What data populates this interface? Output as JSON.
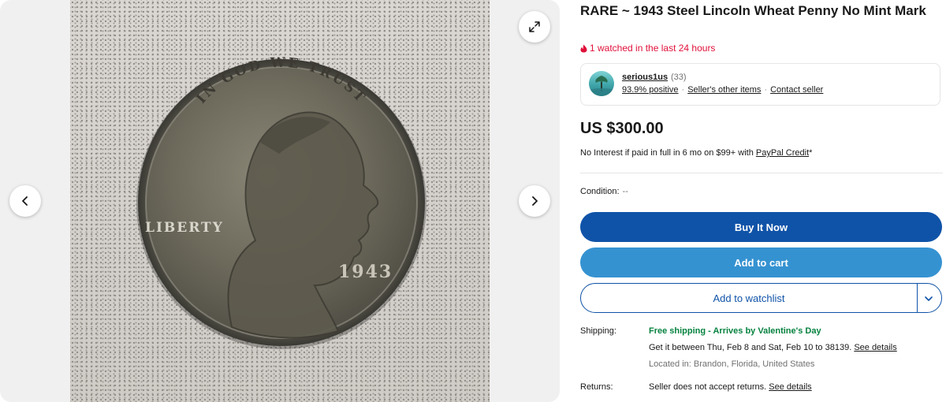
{
  "gallery": {
    "prev_icon": "chevron-left-icon",
    "next_icon": "chevron-right-icon",
    "expand_icon": "expand-icon",
    "coin": {
      "motto": "IN GOD WE TRUST",
      "liberty": "LIBERTY",
      "year": "1943"
    }
  },
  "listing": {
    "title": "RARE ~ 1943 Steel Lincoln Wheat Penny No Mint Mark",
    "watch_note": "1 watched in the last 24 hours",
    "watch_note_color": "#e0103a"
  },
  "seller": {
    "name": "serious1us",
    "count": "(33)",
    "positive": "93.9% positive",
    "other_items": "Seller's other items",
    "contact": "Contact seller",
    "separator": "·"
  },
  "pricing": {
    "price": "US $300.00",
    "credit_text": "No Interest if paid in full in 6 mo on $99+ with ",
    "credit_link": "PayPal Credit",
    "credit_suffix": "*"
  },
  "condition": {
    "label": "Condition:",
    "value": "--"
  },
  "actions": {
    "buy_now": "Buy It Now",
    "add_to_cart": "Add to cart",
    "add_to_watchlist": "Add to watchlist",
    "buy_color": "#0f53a8",
    "cart_color": "#3592d1"
  },
  "shipping": {
    "label": "Shipping:",
    "headline": "Free shipping - Arrives by Valentine's Day",
    "estimate": "Get it between Thu, Feb 8 and Sat, Feb 10 to 38139. ",
    "details_link": "See details",
    "location": "Located in: Brandon, Florida, United States"
  },
  "returns": {
    "label": "Returns:",
    "text": "Seller does not accept returns. ",
    "details_link": "See details"
  }
}
